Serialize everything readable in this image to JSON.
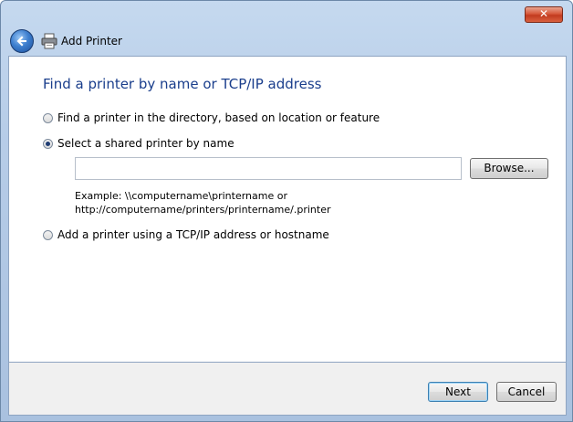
{
  "window": {
    "close_glyph": "✕"
  },
  "nav": {
    "title": "Add Printer",
    "back_icon": "back-arrow-icon",
    "app_icon": "printer-icon"
  },
  "content": {
    "heading": "Find a printer by name or TCP/IP address",
    "options": [
      {
        "label": "Find a printer in the directory, based on location or feature",
        "checked": false
      },
      {
        "label": "Select a shared printer by name",
        "checked": true
      },
      {
        "label": "Add a printer using a TCP/IP address or hostname",
        "checked": false
      }
    ],
    "printer_name_value": "",
    "browse_label": "Browse...",
    "example_line1": "Example: \\\\computername\\printername or",
    "example_line2": "http://computername/printers/printername/.printer"
  },
  "footer": {
    "next_label": "Next",
    "cancel_label": "Cancel"
  },
  "colors": {
    "heading": "#1a3e8c",
    "close_button": "#c23b1f",
    "accent": "#3d7fcf"
  }
}
